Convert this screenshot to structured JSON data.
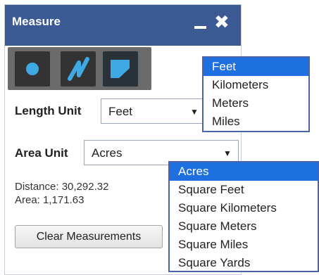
{
  "panel": {
    "title": "Measure",
    "minimize_glyph": "_",
    "close_glyph": "✖"
  },
  "tools": [
    {
      "name": "point",
      "icon": "point-icon"
    },
    {
      "name": "polyline",
      "icon": "polyline-icon"
    },
    {
      "name": "polygon",
      "icon": "polygon-icon",
      "active": true
    }
  ],
  "length": {
    "label": "Length Unit",
    "value": "Feet",
    "options": [
      "Feet",
      "Kilometers",
      "Meters",
      "Miles"
    ]
  },
  "area": {
    "label": "Area Unit",
    "value": "Acres",
    "options": [
      "Acres",
      "Square Feet",
      "Square Kilometers",
      "Square Meters",
      "Square Miles",
      "Square Yards"
    ]
  },
  "results": {
    "distance": "Distance: 30,292.32",
    "area": "Area: 1,171.63"
  },
  "clear_button": "Clear Measurements",
  "colors": {
    "title_bar": "#3b5a94",
    "tool_icon": "#3fa9e5",
    "selected_option": "#1e6fe0"
  }
}
